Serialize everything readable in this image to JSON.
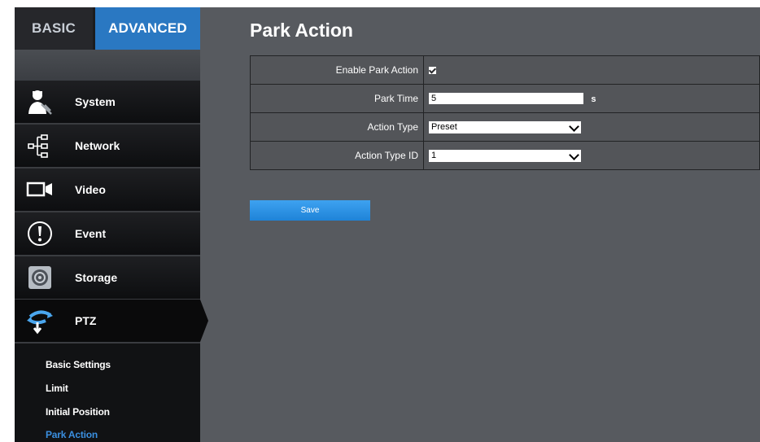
{
  "tabs": {
    "basic": "BASIC",
    "advanced": "ADVANCED"
  },
  "sidebar": {
    "items": [
      {
        "label": "System",
        "icon": "system-user-icon"
      },
      {
        "label": "Network",
        "icon": "network-icon"
      },
      {
        "label": "Video",
        "icon": "video-camera-icon"
      },
      {
        "label": "Event",
        "icon": "exclamation-circle-icon"
      },
      {
        "label": "Storage",
        "icon": "storage-disk-icon"
      },
      {
        "label": "PTZ",
        "icon": "ptz-icon"
      }
    ],
    "sub_items": [
      {
        "label": "Basic Settings"
      },
      {
        "label": "Limit"
      },
      {
        "label": "Initial Position"
      },
      {
        "label": "Park Action",
        "active": true
      }
    ]
  },
  "main": {
    "title": "Park Action",
    "fields": {
      "enable_park_action": {
        "label": "Enable Park Action",
        "checked": true
      },
      "park_time": {
        "label": "Park Time",
        "value": "5",
        "unit": "s"
      },
      "action_type": {
        "label": "Action Type",
        "value": "Preset"
      },
      "action_type_id": {
        "label": "Action Type ID",
        "value": "1"
      }
    },
    "save_label": "Save"
  },
  "colors": {
    "accent": "#2a78c2",
    "button": "#2b8fe4",
    "content_bg": "#575a5f",
    "sidebar_bg": "#111214",
    "active_sub_item": "#3a8fe0"
  }
}
